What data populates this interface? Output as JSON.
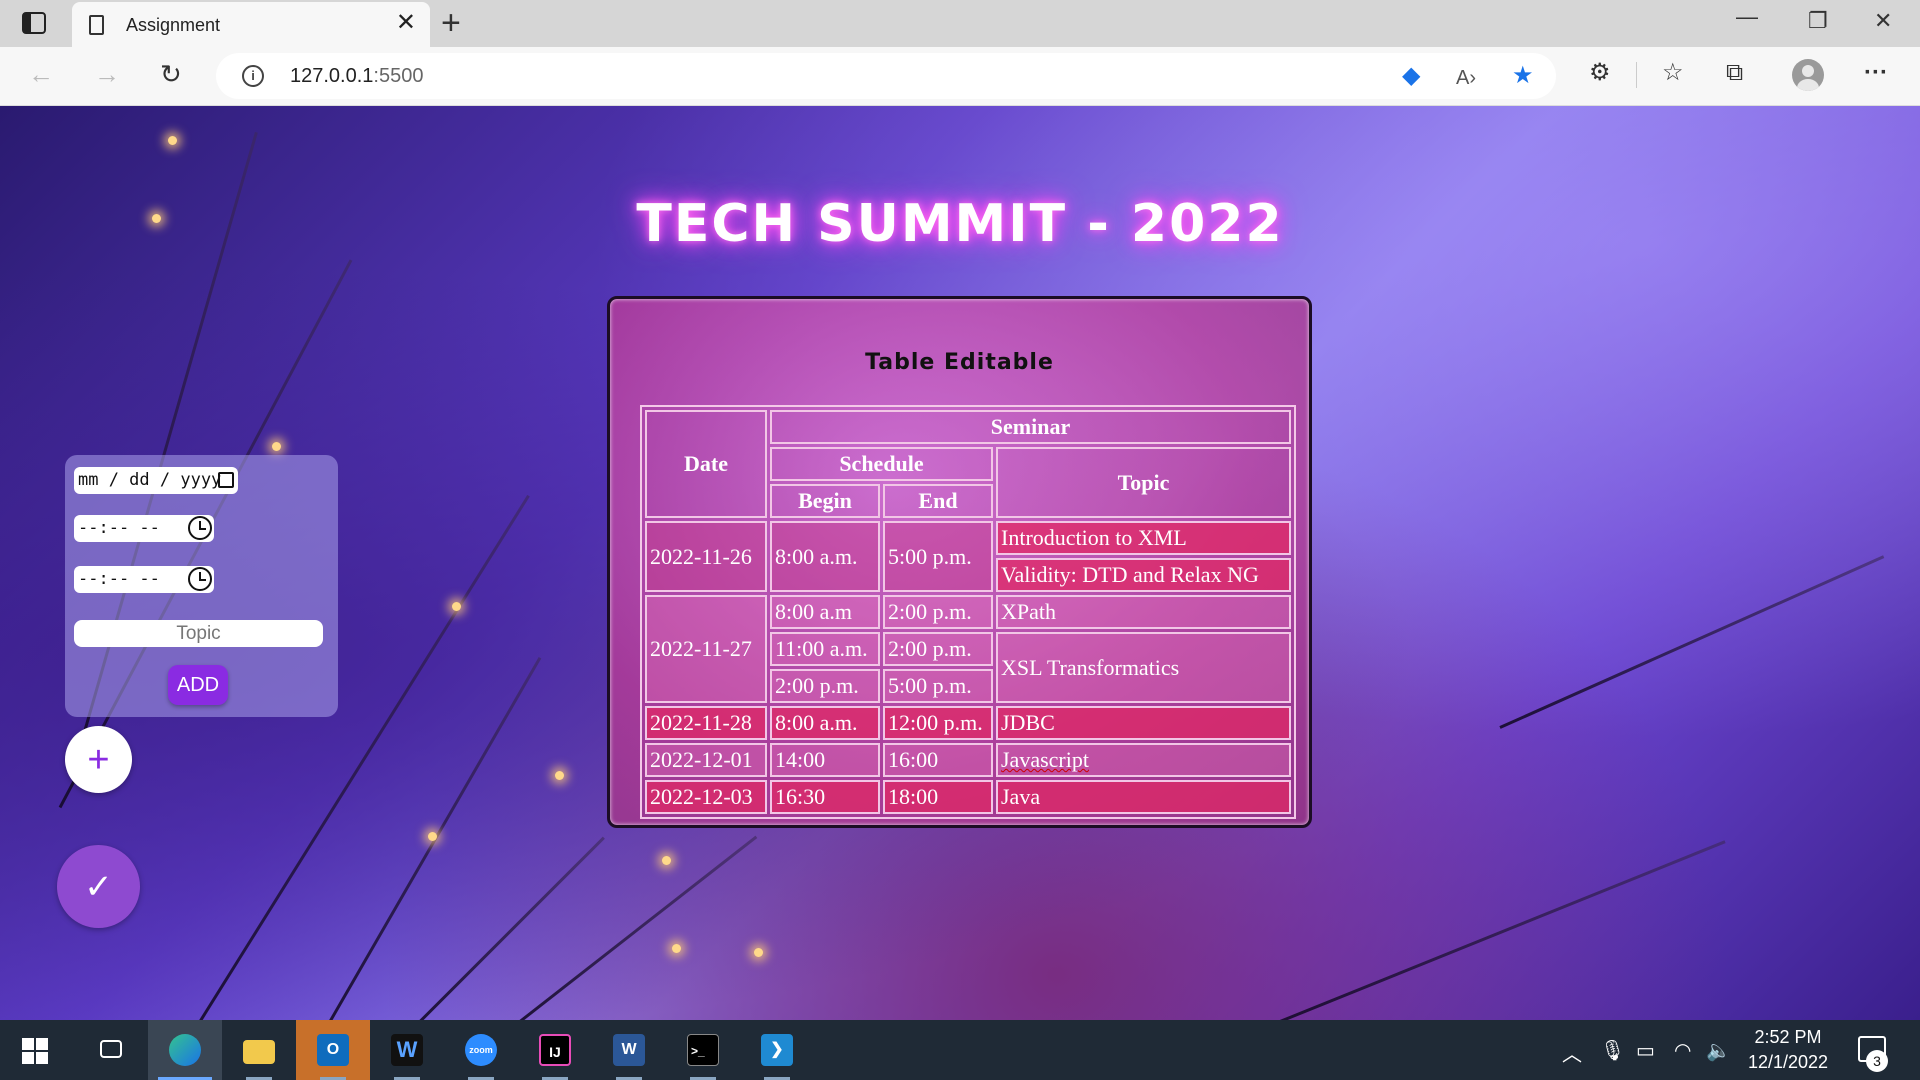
{
  "browser": {
    "tab_title": "Assignment",
    "url_host": "127.0.0.1",
    "url_port": ":5500"
  },
  "page": {
    "title": "TECH SUMMIT - 2022",
    "card_title": "Table Editable",
    "table": {
      "header": {
        "date": "Date",
        "seminar": "Seminar",
        "schedule": "Schedule",
        "begin": "Begin",
        "end": "End",
        "topic": "Topic"
      },
      "rows": [
        {
          "date": "2022-11-26",
          "begin": "8:00 a.m.",
          "end": "5:00 p.m.",
          "topic1": "Introduction to XML",
          "topic2": "Validity: DTD and Relax NG"
        },
        {
          "date": "2022-11-27",
          "slots": [
            {
              "begin": "8:00 a.m",
              "end": "2:00 p.m.",
              "topic": "XPath"
            },
            {
              "begin": "11:00 a.m.",
              "end": "2:00 p.m.",
              "topic": "XSL Transformatics"
            },
            {
              "begin": "2:00 p.m.",
              "end": "5:00 p.m."
            }
          ]
        },
        {
          "date": "2022-11-28",
          "begin": "8:00 a.m.",
          "end": "12:00 p.m.",
          "topic": "JDBC"
        },
        {
          "date": "2022-12-01",
          "begin": "14:00",
          "end": "16:00",
          "topic": "Javascript"
        },
        {
          "date": "2022-12-03",
          "begin": "16:30",
          "end": "18:00",
          "topic": "Java"
        }
      ]
    },
    "form": {
      "date_placeholder": "mm / dd / yyyy",
      "time_placeholder": "--:-- --",
      "topic_placeholder": "Topic",
      "add_label": "ADD"
    },
    "fab_plus": "+",
    "fab_check": "✓"
  },
  "taskbar": {
    "time": "2:52 PM",
    "date": "12/1/2022",
    "notification_count": "3",
    "apps": [
      "start-icon",
      "task-view-icon",
      "edge-icon",
      "file-explorer-icon",
      "outlook-icon",
      "webex-icon",
      "zoom-icon",
      "intellij-icon",
      "word-icon",
      "terminal-icon",
      "vscode-icon"
    ]
  }
}
